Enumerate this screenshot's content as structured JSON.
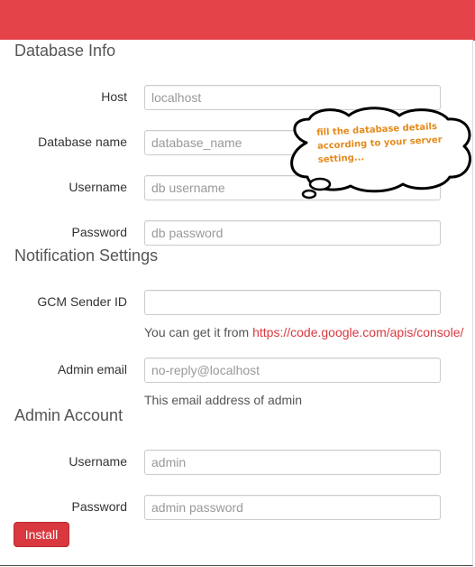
{
  "sections": {
    "database": "Database Info",
    "notification": "Notification Settings",
    "admin": "Admin Account"
  },
  "fields": {
    "host": {
      "label": "Host",
      "placeholder": "localhost"
    },
    "db_name": {
      "label": "Database name",
      "placeholder": "database_name"
    },
    "db_username": {
      "label": "Username",
      "placeholder": "db username"
    },
    "db_password": {
      "label": "Password",
      "placeholder": "db password"
    },
    "gcm_sender": {
      "label": "GCM Sender ID",
      "placeholder": ""
    },
    "admin_email": {
      "label": "Admin email",
      "placeholder": "no-reply@localhost"
    },
    "admin_username": {
      "label": "Username",
      "placeholder": "admin"
    },
    "admin_password": {
      "label": "Password",
      "placeholder": "admin password"
    }
  },
  "help": {
    "gcm_prefix": "You can get it from ",
    "gcm_link": "https://code.google.com/apis/console/",
    "admin_email": "This email address of admin"
  },
  "callout": {
    "text": "fill the database details\naccording to your server\nsetting..."
  },
  "buttons": {
    "install": "Install"
  },
  "colors": {
    "accent": "#e5434a",
    "button": "#d9383f",
    "callout_text": "#e58a1a"
  }
}
